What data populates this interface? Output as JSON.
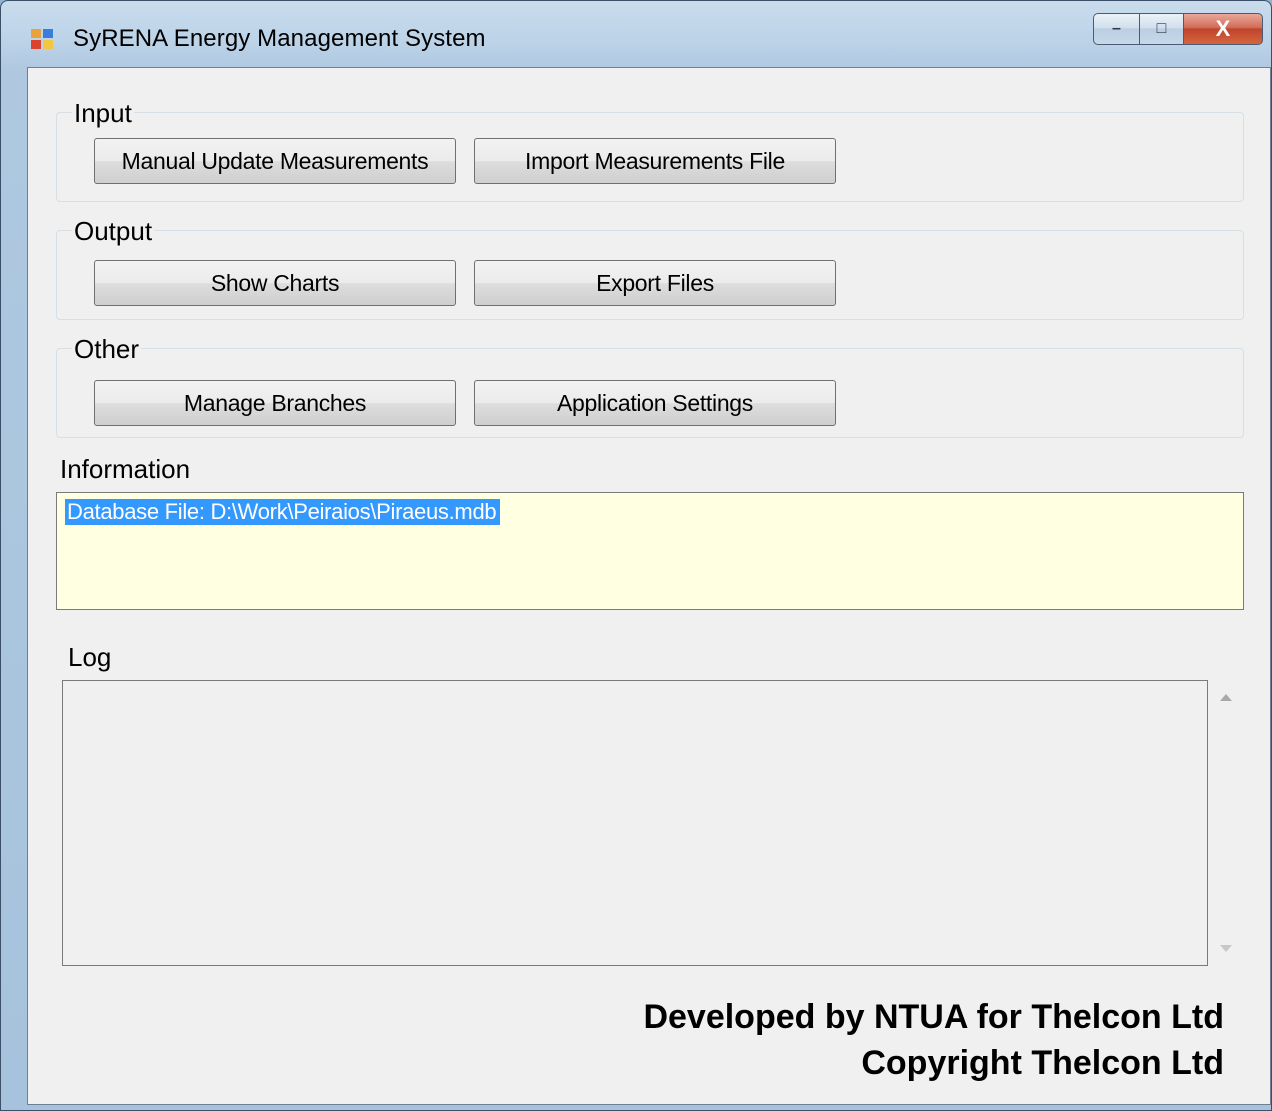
{
  "window": {
    "title": "SyRENA Energy Management System",
    "icon": "app-window-icon",
    "controls": {
      "minimize": "–",
      "maximize": "□",
      "close": "X"
    }
  },
  "input_group": {
    "label": "Input",
    "buttons": [
      {
        "label": "Manual Update Measurements"
      },
      {
        "label": "Import Measurements File"
      }
    ]
  },
  "output_group": {
    "label": "Output",
    "buttons": [
      {
        "label": "Show Charts"
      },
      {
        "label": "Export Files"
      }
    ]
  },
  "other_group": {
    "label": "Other",
    "buttons": [
      {
        "label": "Manage Branches"
      },
      {
        "label": "Application Settings"
      }
    ]
  },
  "information": {
    "label": "Information",
    "lines": [
      "Database File: D:\\Work\\Peiraios\\Piraeus.mdb"
    ]
  },
  "log": {
    "label": "Log",
    "entries": []
  },
  "footer": {
    "line1": "Developed by NTUA for Thelcon Ltd",
    "line2": "Copyright Thelcon Ltd"
  },
  "colors": {
    "info_background": "#ffffe1",
    "selection": "#3399ff",
    "close_button": "#c0442c"
  }
}
